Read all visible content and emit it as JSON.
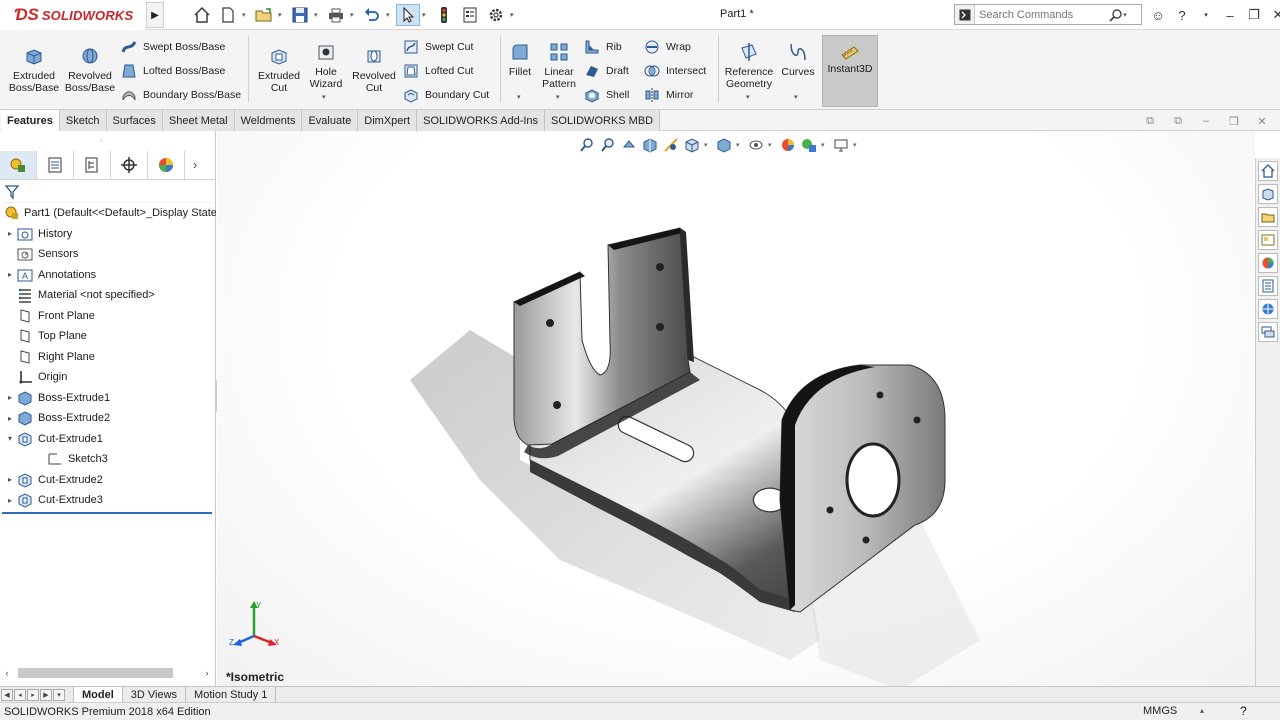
{
  "app": {
    "brand": "SOLIDWORKS",
    "doc_title": "Part1 *",
    "search_placeholder": "Search Commands"
  },
  "ribbon": {
    "extruded_boss": "Extruded Boss/Base",
    "revolved_boss": "Revolved Boss/Base",
    "swept_boss": "Swept Boss/Base",
    "lofted_boss": "Lofted Boss/Base",
    "boundary_boss": "Boundary Boss/Base",
    "extruded_cut": "Extruded Cut",
    "hole_wizard": "Hole Wizard",
    "revolved_cut": "Revolved Cut",
    "swept_cut": "Swept Cut",
    "lofted_cut": "Lofted Cut",
    "boundary_cut": "Boundary Cut",
    "fillet": "Fillet",
    "linear_pattern": "Linear Pattern",
    "rib": "Rib",
    "draft": "Draft",
    "shell": "Shell",
    "wrap": "Wrap",
    "intersect": "Intersect",
    "mirror": "Mirror",
    "reference_geometry": "Reference Geometry",
    "curves": "Curves",
    "instant3d": "Instant3D"
  },
  "tabs": [
    "Features",
    "Sketch",
    "Surfaces",
    "Sheet Metal",
    "Weldments",
    "Evaluate",
    "DimXpert",
    "SOLIDWORKS Add-Ins",
    "SOLIDWORKS MBD"
  ],
  "tree": {
    "root": "Part1  (Default<<Default>_Display State",
    "items": [
      "History",
      "Sensors",
      "Annotations",
      "Material <not specified>",
      "Front Plane",
      "Top Plane",
      "Right Plane",
      "Origin",
      "Boss-Extrude1",
      "Boss-Extrude2",
      "Cut-Extrude1",
      "Sketch3",
      "Cut-Extrude2",
      "Cut-Extrude3"
    ]
  },
  "viewport": {
    "view_name": "*Isometric",
    "triad_x": "X",
    "triad_y": "Y",
    "triad_z": "Z"
  },
  "bottom_tabs": [
    "Model",
    "3D Views",
    "Motion Study 1"
  ],
  "status": {
    "edition": "SOLIDWORKS Premium 2018 x64 Edition",
    "units": "MMGS"
  },
  "colors": {
    "brand_red": "#c8252a",
    "selection_blue": "#2a6fb8",
    "instant3d_active": "#c9c9c9"
  }
}
